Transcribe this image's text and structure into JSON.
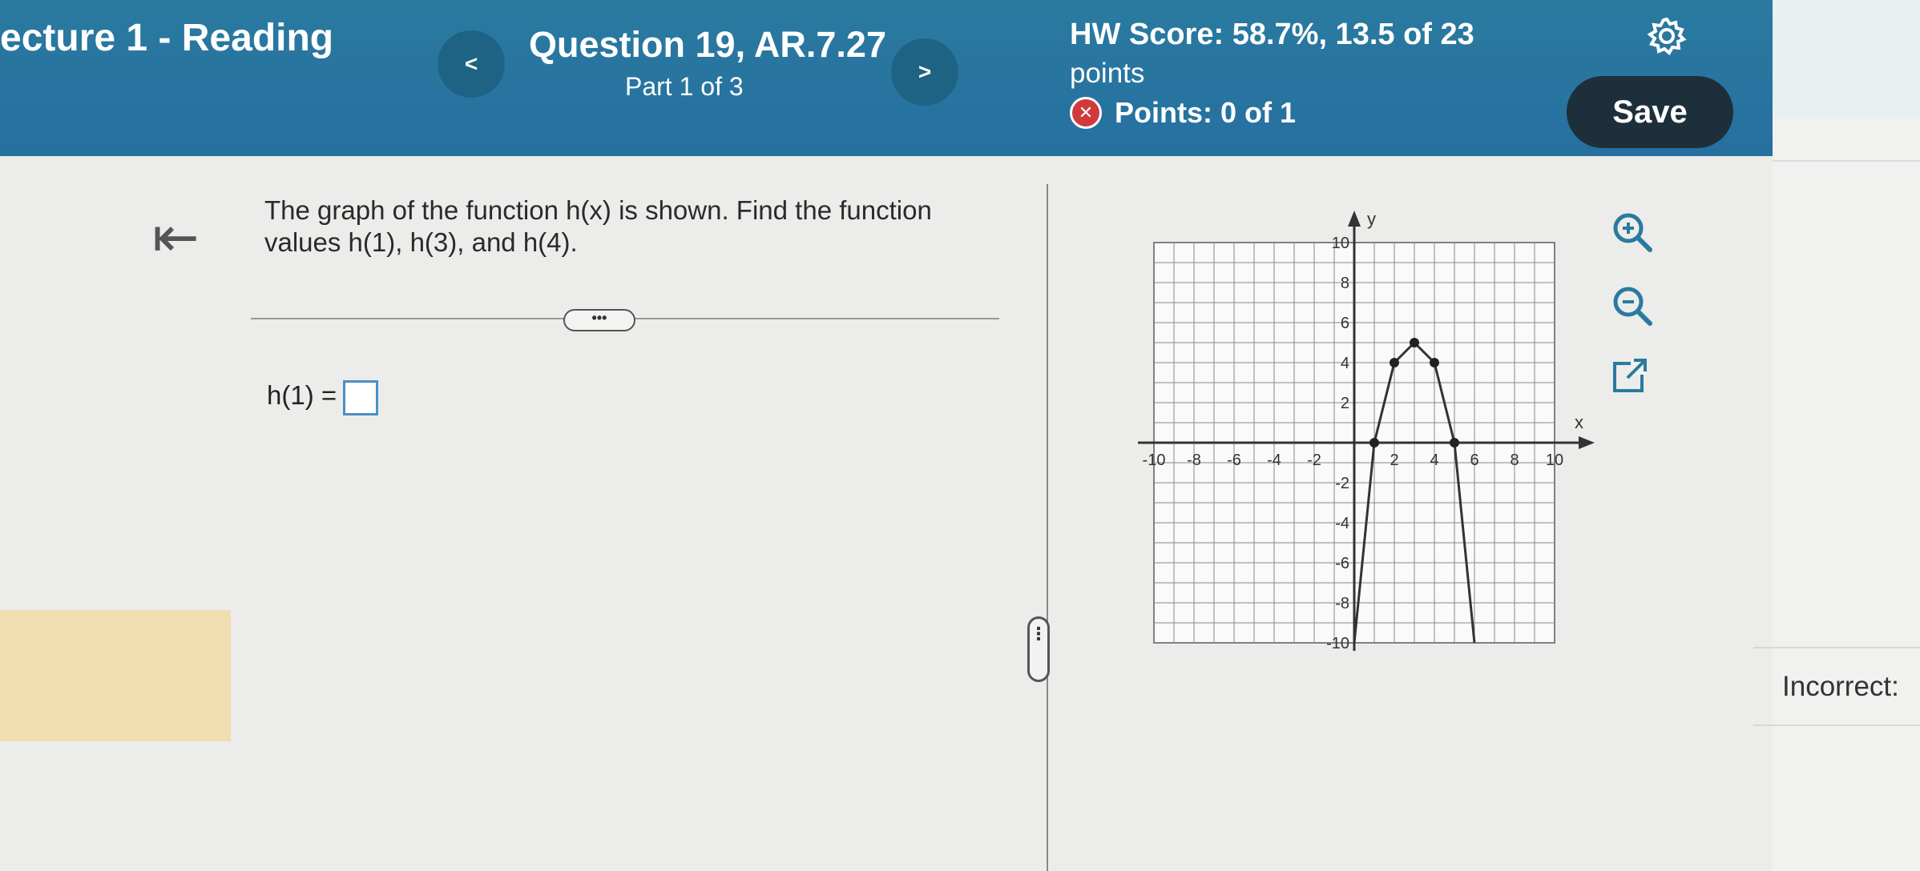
{
  "header": {
    "lecture_title": "ecture 1 - Reading",
    "prev_label": "<",
    "next_label": ">",
    "question_title": "Question 19, AR.7.27",
    "question_part": "Part 1 of 3",
    "hw_score": "HW Score: 58.7%, 13.5 of 23",
    "hw_points": "points",
    "points_status_icon": "x-circle-icon",
    "points": "Points: 0 of 1",
    "settings_icon": "gear-icon",
    "save_label": "Save"
  },
  "question": {
    "text_line1": "The graph of the function h(x) is shown. Find the function",
    "text_line2": "values h(1), h(3), and h(4).",
    "expand_label": "•••",
    "answer_label": "h(1) =",
    "answer_value": ""
  },
  "tools": {
    "zoom_in": "zoom-in-icon",
    "zoom_out": "zoom-out-icon",
    "popout": "external-link-icon"
  },
  "side": {
    "incorrect_label": "Incorrect:"
  },
  "chart_data": {
    "type": "line",
    "xlabel": "x",
    "ylabel": "y",
    "xlim": [
      -10,
      10
    ],
    "ylim": [
      -10,
      10
    ],
    "x_ticks": [
      "-10",
      "-8",
      "-6",
      "-4",
      "-2",
      "2",
      "4",
      "6",
      "8",
      "10"
    ],
    "y_ticks": [
      "10",
      "8",
      "6",
      "4",
      "2",
      "-2",
      "-4",
      "-6",
      "-8",
      "-10"
    ],
    "grid": true,
    "series": [
      {
        "points": [
          [
            0,
            -10
          ],
          [
            1,
            0
          ],
          [
            2,
            4
          ],
          [
            3,
            5
          ],
          [
            4,
            4
          ],
          [
            5,
            0
          ],
          [
            6,
            -10
          ]
        ],
        "marked_points": [
          [
            1,
            0
          ],
          [
            2,
            4
          ],
          [
            3,
            5
          ],
          [
            4,
            4
          ],
          [
            5,
            0
          ]
        ]
      }
    ]
  },
  "colors": {
    "header_bg": "#2a7aa0",
    "save_bg": "#1d2f3a",
    "answer_border": "#4a8fc5",
    "highlight": "#f0ddb0",
    "error": "#d13a3a"
  }
}
